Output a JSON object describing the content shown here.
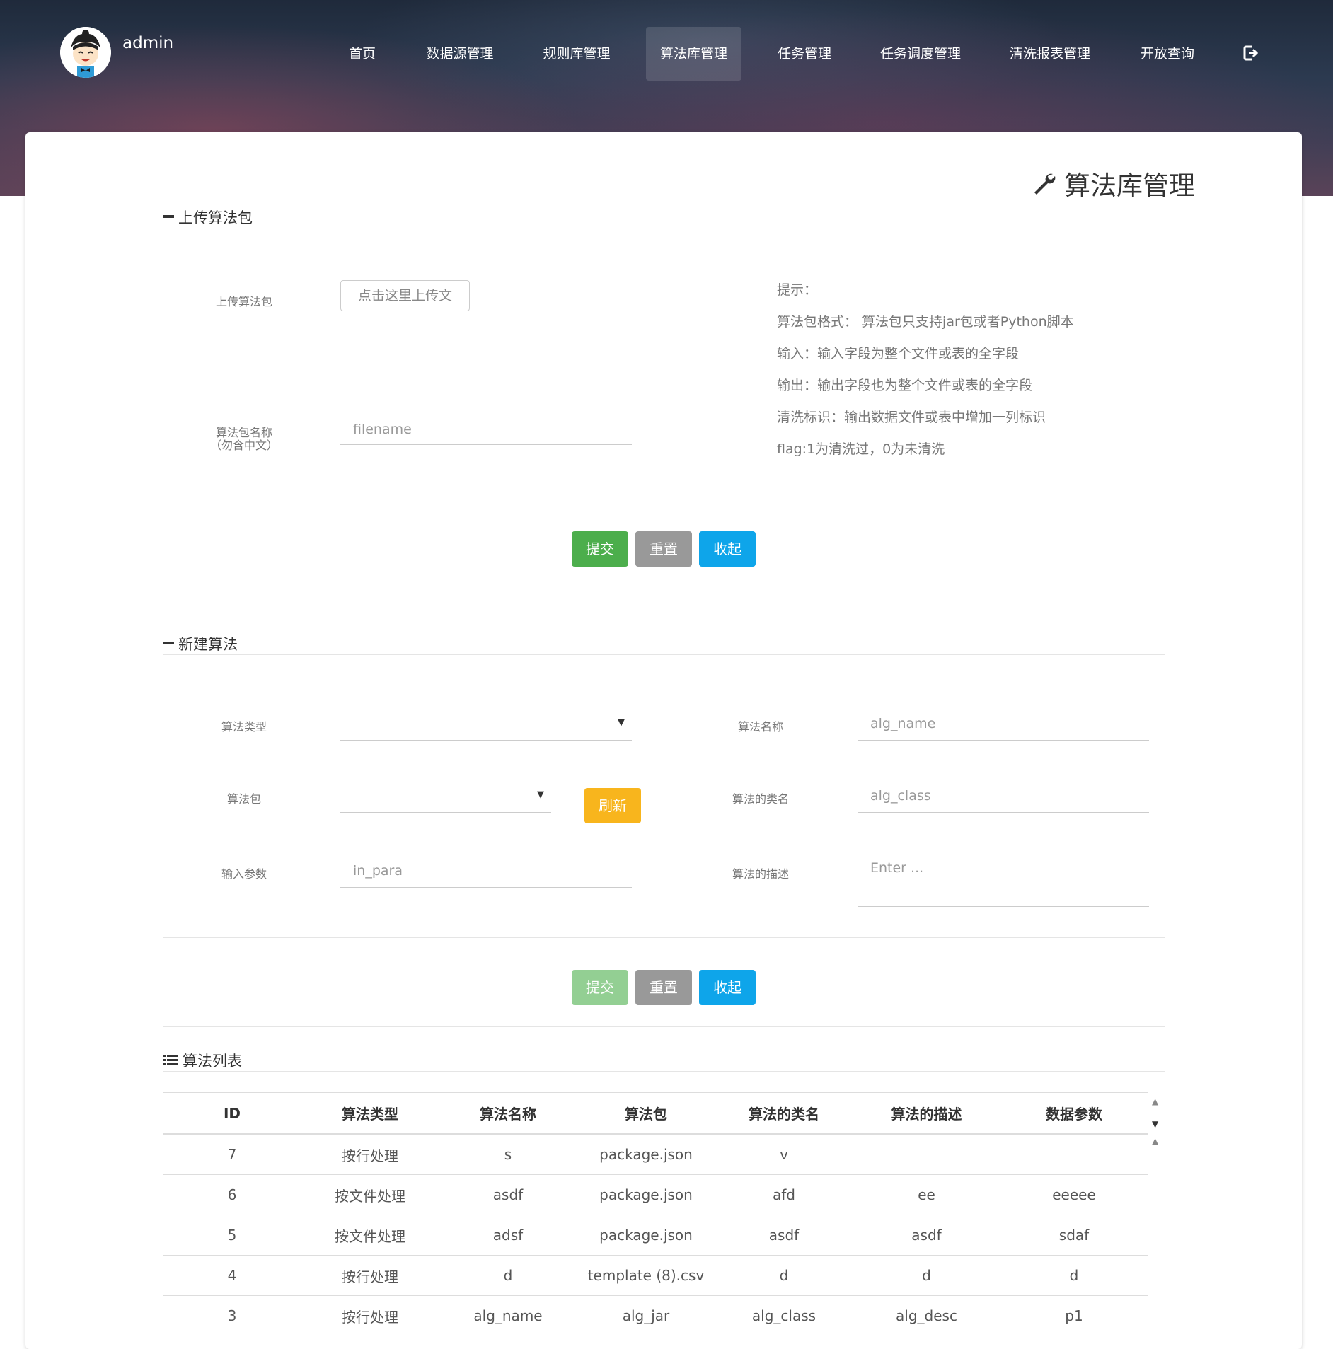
{
  "header": {
    "username": "admin",
    "nav": [
      "首页",
      "数据源管理",
      "规则库管理",
      "算法库管理",
      "任务管理",
      "任务调度管理",
      "清洗报表管理",
      "开放查询"
    ],
    "active_nav": "算法库管理"
  },
  "page_title": "算法库管理",
  "upload_section": {
    "title": "上传算法包",
    "upload_label": "上传算法包",
    "upload_button": "点击这里上传文",
    "name_label_line1": "算法包名称",
    "name_label_line2": "（勿含中文）",
    "name_placeholder": "filename",
    "tips": [
      "提示：",
      "算法包格式： 算法包只支持jar包或者Python脚本",
      "输入：输入字段为整个文件或表的全字段",
      "输出：输出字段也为整个文件或表的全字段",
      "清洗标识：输出数据文件或表中增加一列标识",
      "flag:1为清洗过，0为未清洗"
    ],
    "buttons": {
      "submit": "提交",
      "reset": "重置",
      "collapse": "收起"
    }
  },
  "new_section": {
    "title": "新建算法",
    "type_label": "算法类型",
    "name_label": "算法名称",
    "name_placeholder": "alg_name",
    "package_label": "算法包",
    "refresh": "刷新",
    "class_label": "算法的类名",
    "class_placeholder": "alg_class",
    "input_label": "输入参数",
    "input_placeholder": "in_para",
    "desc_label": "算法的描述",
    "desc_placeholder": "Enter ...",
    "buttons": {
      "submit": "提交",
      "reset": "重置",
      "collapse": "收起"
    }
  },
  "list_section": {
    "title": "算法列表",
    "columns": [
      "ID",
      "算法类型",
      "算法名称",
      "算法包",
      "算法的类名",
      "算法的描述",
      "数据参数"
    ],
    "rows": [
      [
        "7",
        "按行处理",
        "s",
        "package.json",
        "v",
        "",
        ""
      ],
      [
        "6",
        "按文件处理",
        "asdf",
        "package.json",
        "afd",
        "ee",
        "eeeee"
      ],
      [
        "5",
        "按文件处理",
        "adsf",
        "package.json",
        "asdf",
        "asdf",
        "sdaf"
      ],
      [
        "4",
        "按行处理",
        "d",
        "template (8).csv",
        "d",
        "d",
        "d"
      ],
      [
        "3",
        "按行处理",
        "alg_name",
        "alg_jar",
        "alg_class",
        "alg_desc",
        "p1"
      ]
    ]
  },
  "colors": {
    "green": "#4cae4c",
    "gray": "#999999",
    "blue": "#0ea5ea",
    "orange": "#f8b51d"
  }
}
